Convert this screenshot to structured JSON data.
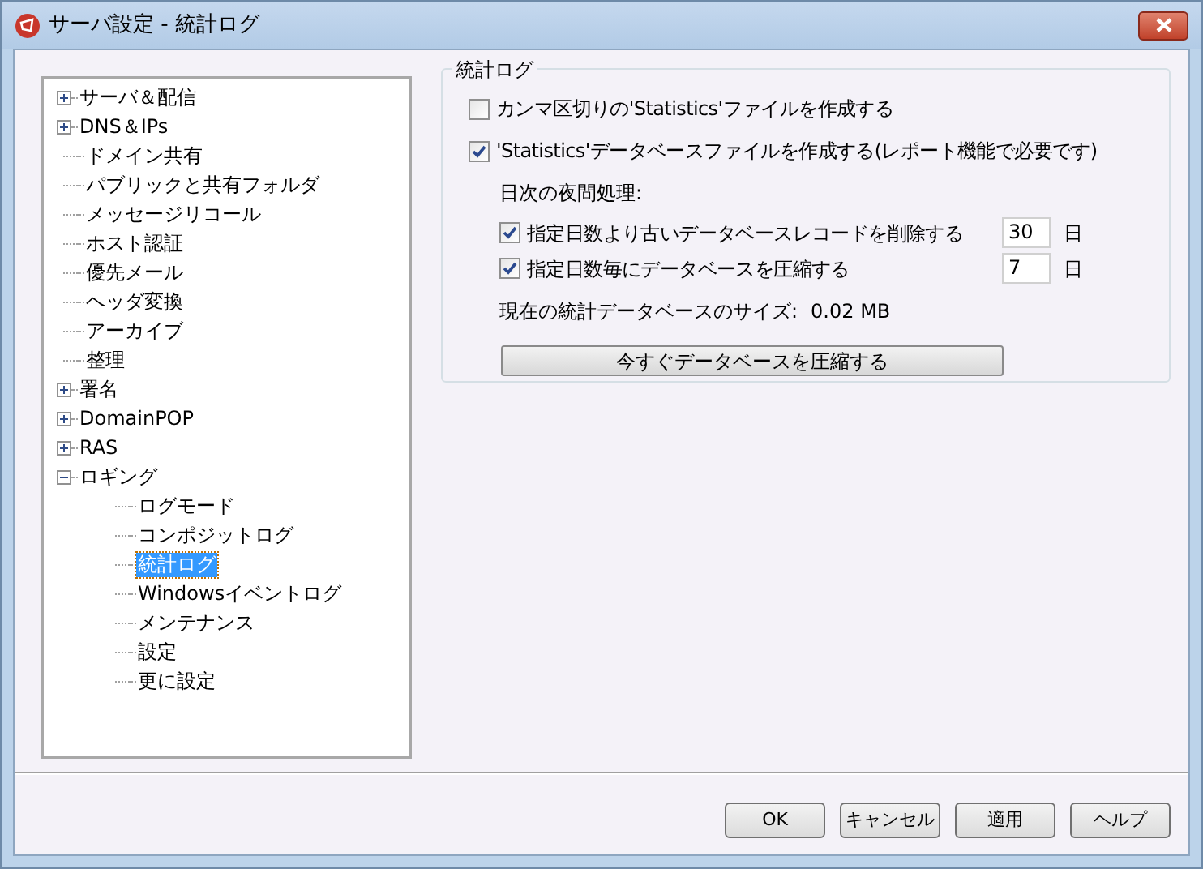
{
  "window": {
    "title": "サーバ設定 - 統計ログ"
  },
  "tree": [
    {
      "label": "サーバ＆配信",
      "expanded": false,
      "selected": false
    },
    {
      "label": "DNS＆IPs",
      "expanded": false,
      "selected": false
    },
    {
      "label": "ドメイン共有",
      "selected": false
    },
    {
      "label": "パブリックと共有フォルダ",
      "selected": false
    },
    {
      "label": "メッセージリコール",
      "selected": false
    },
    {
      "label": "ホスト認証",
      "selected": false
    },
    {
      "label": "優先メール",
      "selected": false
    },
    {
      "label": "ヘッダ変換",
      "selected": false
    },
    {
      "label": "アーカイブ",
      "selected": false
    },
    {
      "label": "整理",
      "selected": false
    },
    {
      "label": "署名",
      "expanded": false,
      "selected": false
    },
    {
      "label": "DomainPOP",
      "expanded": false,
      "selected": false
    },
    {
      "label": "RAS",
      "expanded": false,
      "selected": false
    },
    {
      "label": "ロギング",
      "expanded": true,
      "selected": false,
      "children": [
        {
          "label": "ログモード",
          "selected": false
        },
        {
          "label": "コンポジットログ",
          "selected": false
        },
        {
          "label": "統計ログ",
          "selected": true
        },
        {
          "label": "Windowsイベントログ",
          "selected": false
        },
        {
          "label": "メンテナンス",
          "selected": false
        },
        {
          "label": "設定",
          "selected": false
        },
        {
          "label": "更に設定",
          "selected": false
        }
      ]
    }
  ],
  "group": {
    "title": "統計ログ",
    "options": [
      {
        "label": "カンマ区切りの'Statistics'ファイルを作成する",
        "checked": false
      },
      {
        "label": "'Statistics'データベースファイルを作成する(レポート機能で必要です)",
        "checked": true
      }
    ],
    "nightly_label": "日次の夜間処理:",
    "nightly": [
      {
        "label": "指定日数より古いデータベースレコードを削除する",
        "checked": true,
        "value": "30",
        "unit": "日"
      },
      {
        "label": "指定日数毎にデータベースを圧縮する",
        "checked": true,
        "value": "7",
        "unit": "日"
      }
    ],
    "size_label": "現在の統計データベースのサイズ:",
    "size_value": "0.02 MB",
    "compress_button": "今すぐデータベースを圧縮する"
  },
  "buttons": [
    "OK",
    "キャンセル",
    "適用",
    "ヘルプ"
  ]
}
